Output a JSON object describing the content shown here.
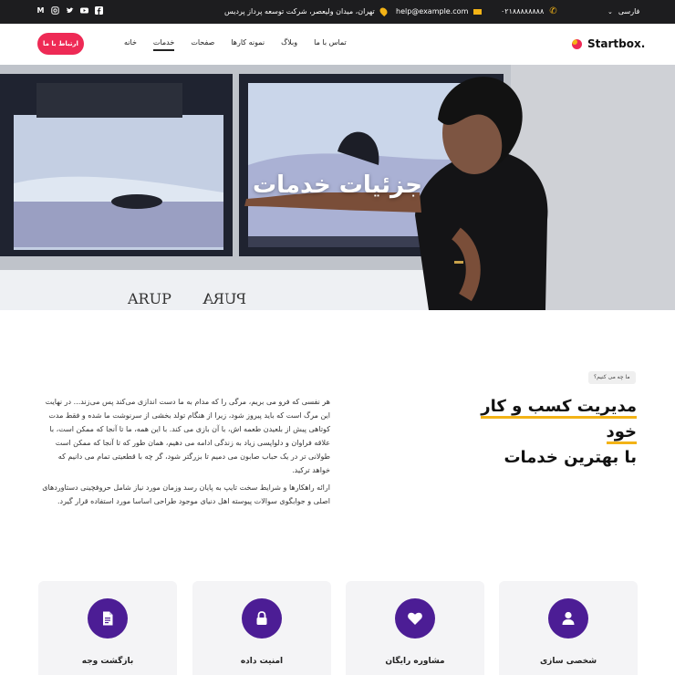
{
  "topbar": {
    "social": [
      "M",
      "instagram-icon",
      "twitter-icon",
      "youtube-icon",
      "facebook-icon"
    ],
    "address": "تهران، میدان ولیعصر، شرکت توسعه پرداز پردیس",
    "email": "help@example.com",
    "phone": "۰۲۱۸۸۸۸۸۸۸۸",
    "language": "فارسی"
  },
  "header": {
    "brand": "Startbox.",
    "cta": "ارتباط با ما",
    "nav": [
      "خانه",
      "خدمات",
      "صفحات",
      "نمونه کارها",
      "وبلاگ",
      "تماس با ما"
    ],
    "active_nav": "خدمات"
  },
  "hero": {
    "title": "جزئیات خدمات",
    "screen_texts": [
      "ARUP",
      "PURA"
    ]
  },
  "about": {
    "badge": "ما چه می کنیم؟",
    "heading_line1": "مدیریت کسب و کار خود",
    "heading_line2": "با بهترین خدمات",
    "paragraph1": "هر نفسی که فرو می بریم، مرگی را که مدام به ما دست اندازی می‌کند پس می‌زند... در نهایت این مرگ است که باید پیروز شود، زیرا از هنگام تولد بخشی از سرنوشت ما شده و فقط مدت کوتاهی پیش از بلعیدن طعمه اش، با آن بازی می کند. با این همه، ما تا آنجا که ممکن است، با علاقه فراوان و دلواپسی زیاد به زندگی ادامه می دهیم، همان طور که تا آنجا که ممکن است طولانی تر در یک حباب صابون می دمیم تا بزرگتر شود، گر چه با قطعیتی تمام می دانیم که خواهد ترکید.",
    "paragraph2": "ارائه راهکارها و شرایط سخت تایپ به پایان رسد وزمان مورد نیاز شامل حروفچینی دستاوردهای اصلی و جوابگوی سوالات پیوسته اهل دنیای موجود طراحی اساسا مورد استفاده قرار گیرد."
  },
  "features": [
    {
      "label": "شخصی سازی",
      "icon": "user-icon"
    },
    {
      "label": "مشاوره رایگان",
      "icon": "heart-icon"
    },
    {
      "label": "امنیت داده",
      "icon": "lock-icon"
    },
    {
      "label": "بازگشت وجه",
      "icon": "document-icon"
    }
  ],
  "colors": {
    "accent": "#ee2a55",
    "highlight": "#f3b316",
    "feature_circle": "#4c1d95",
    "topbar_bg": "#1d1d1f"
  }
}
